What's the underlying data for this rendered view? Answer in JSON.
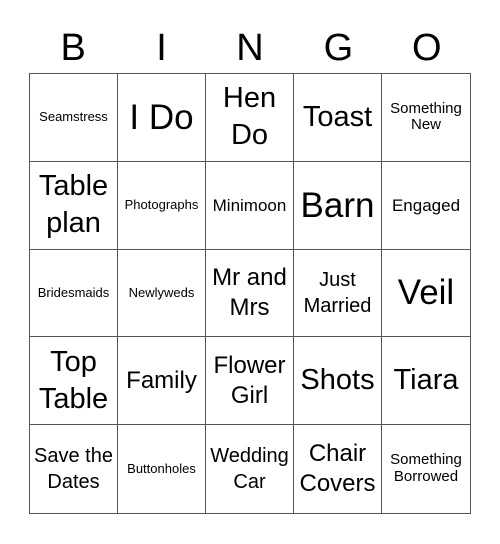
{
  "header": [
    "B",
    "I",
    "N",
    "G",
    "O"
  ],
  "cells": [
    "Seamstress",
    "I Do",
    "Hen Do",
    "Toast",
    "Something New",
    "Table plan",
    "Photographs",
    "Minimoon",
    "Barn",
    "Engaged",
    "Bridesmaids",
    "Newlyweds",
    "Mr and Mrs",
    "Just Married",
    "Veil",
    "Top Table",
    "Family",
    "Flower Girl",
    "Shots",
    "Tiara",
    "Save the Dates",
    "Buttonholes",
    "Wedding Car",
    "Chair Covers",
    "Something Borrowed"
  ]
}
